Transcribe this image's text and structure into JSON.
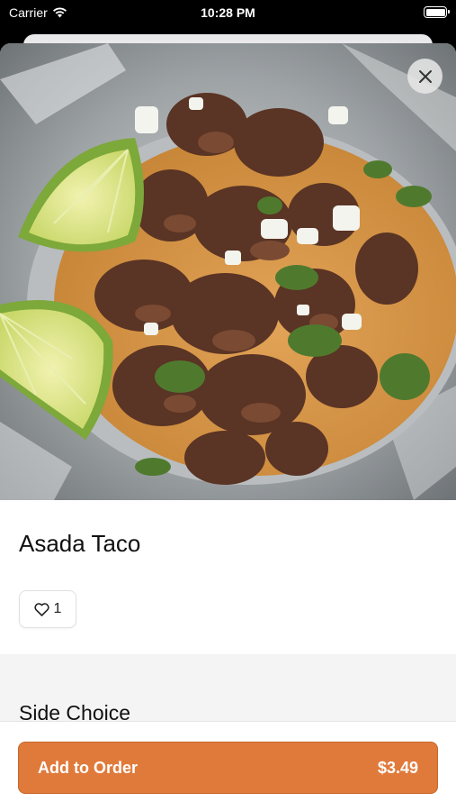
{
  "status_bar": {
    "carrier": "Carrier",
    "time": "10:28 PM"
  },
  "item": {
    "title": "Asada Taco",
    "likes": "1",
    "image_icon": "taco-photo"
  },
  "options": {
    "section_title": "Side Choice"
  },
  "footer": {
    "add_label": "Add to Order",
    "price": "$3.49"
  },
  "colors": {
    "accent": "#e07a3b",
    "options_background": "#f4f4f5"
  }
}
